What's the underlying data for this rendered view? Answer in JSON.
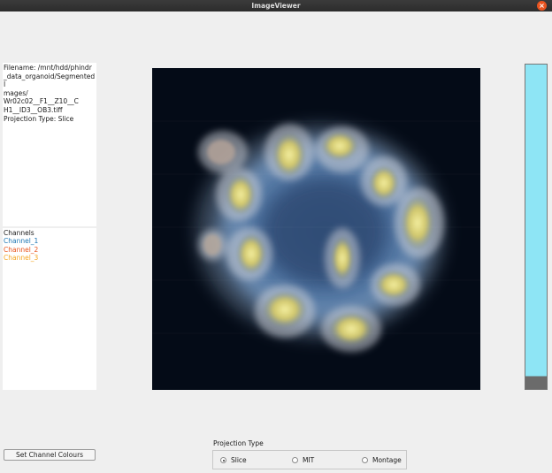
{
  "window": {
    "title": "ImageViewer",
    "close_glyph": "×"
  },
  "info": {
    "filename_lines": [
      "Filename: /mnt/hdd/phindr",
      "_data_organoid/SegmentedI",
      "mages/",
      "Wr02c02__F1__Z10__C",
      "H1__ID3__OB3.tiff"
    ],
    "projection_line": "Projection Type: Slice"
  },
  "channels": {
    "header": "Channels",
    "items": [
      {
        "label": "Channel_1",
        "color": "#1f77b4"
      },
      {
        "label": "Channel_2",
        "color": "#e8541c"
      },
      {
        "label": "Channel_3",
        "color": "#f5a623"
      }
    ]
  },
  "scale_bar": {
    "fill_color": "#8ee5f5",
    "bottom_color": "#6b6b6b"
  },
  "buttons": {
    "set_colours": "Set Channel Colours"
  },
  "projection": {
    "label": "Projection Type",
    "options": [
      {
        "label": "Slice",
        "checked": true
      },
      {
        "label": "MIT",
        "checked": false
      },
      {
        "label": "Montage",
        "checked": false
      }
    ]
  }
}
